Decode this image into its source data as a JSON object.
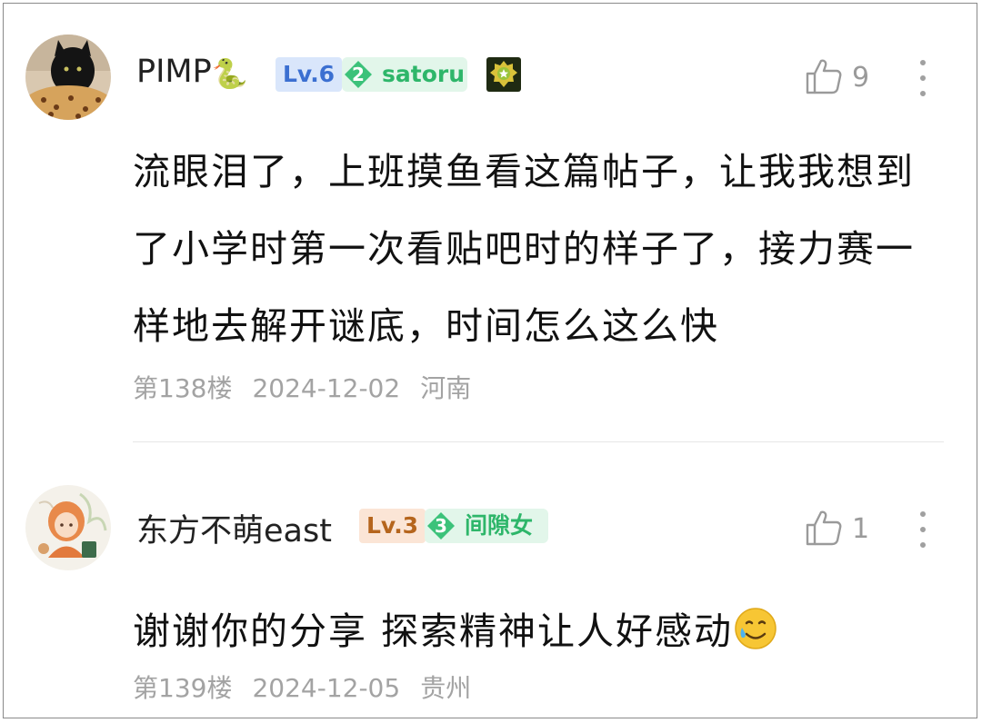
{
  "comments": [
    {
      "username": "PIMP",
      "name_emoji": "🐍",
      "level": "Lv.6",
      "fan_level": "2",
      "fan_group": "satoru",
      "likes": "9",
      "text": "流眼泪了，上班摸鱼看这篇帖子，让我我想到了小学时第一次看贴吧时的样子了，接力赛一样地去解开谜底，时间怎么这么快",
      "floor": "第138楼",
      "date": "2024-12-02",
      "location": "河南"
    },
    {
      "username": "东方不萌east",
      "level": "Lv.3",
      "fan_level": "3",
      "fan_group": "间隙女",
      "likes": "1",
      "text": "谢谢你的分享 探索精神让人好感动",
      "floor": "第139楼",
      "date": "2024-12-05",
      "location": "贵州"
    }
  ],
  "icons": {
    "like": "thumbs-up-outline-icon",
    "more": "vertical-ellipsis-icon",
    "medal": "star-medal-icon",
    "tear_smile": "smiling-face-with-tear-emoji"
  },
  "colors": {
    "lv6_bg": "#d9e6fb",
    "lv6_text": "#3b6fd1",
    "lv3_bg": "#fbe5d6",
    "lv3_text": "#b5651d",
    "fan_badge_bg": "#e2f6ea",
    "fan_text": "#2eb66a",
    "meta_text": "#a3a3a3"
  }
}
